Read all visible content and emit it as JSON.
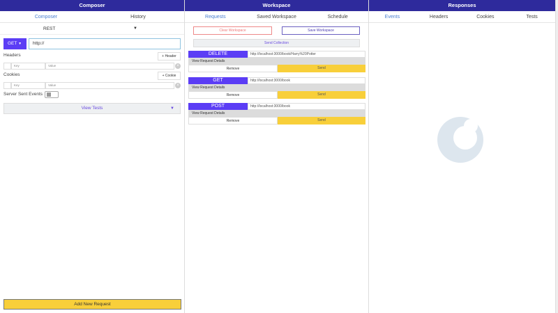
{
  "composer": {
    "title": "Composer",
    "tabs": [
      "Composer",
      "History"
    ],
    "protocol": "REST",
    "method": "GET",
    "url": "http://",
    "headers_label": "Headers",
    "add_header": "+ Header",
    "key_placeholder": "Key",
    "value_placeholder": "Value",
    "cookies_label": "Cookies",
    "add_cookie": "+ Cookie",
    "sse_label": "Server Sent Events",
    "view_tests": "View Tests",
    "add_request": "Add New Request"
  },
  "workspace": {
    "title": "Workspace",
    "tabs": [
      "Requests",
      "Saved Workspace",
      "Schedule"
    ],
    "clear": "Clear Workspace",
    "save": "Save Workspace",
    "send_collection": "Send Collection",
    "requests": [
      {
        "method": "DELETE",
        "url": "http://localhost:3000/book/Harry%20Potter",
        "details": "View Request Details",
        "remove": "Remove",
        "send": "Send"
      },
      {
        "method": "GET",
        "url": "http://localhost:3000/book",
        "details": "View Request Details",
        "remove": "Remove",
        "send": "Send"
      },
      {
        "method": "POST",
        "url": "http://localhost:3000/book",
        "details": "View Request Details",
        "remove": "Remove",
        "send": "Send"
      }
    ]
  },
  "responses": {
    "title": "Responses",
    "tabs": [
      "Events",
      "Headers",
      "Cookies",
      "Tests"
    ]
  },
  "colors": {
    "header": "#2e2a9c",
    "method": "#5b3df5",
    "send": "#f8cf3a"
  }
}
